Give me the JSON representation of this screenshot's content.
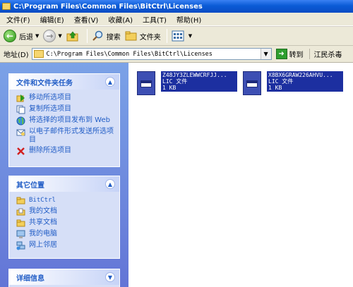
{
  "window": {
    "title": "C:\\Program Files\\Common Files\\BitCtrl\\Licenses"
  },
  "menu": [
    "文件(F)",
    "编辑(E)",
    "查看(V)",
    "收藏(A)",
    "工具(T)",
    "帮助(H)"
  ],
  "toolbar": {
    "back_label": "后退",
    "search_label": "搜索",
    "folders_label": "文件夹"
  },
  "address": {
    "label": "地址(D)",
    "value": "C:\\Program Files\\Common Files\\BitCtrl\\Licenses",
    "go_label": "转到",
    "extra_label": "江民杀毒"
  },
  "tasks_panel": {
    "title": "文件和文件夹任务",
    "items": [
      "移动所选项目",
      "复制所选项目",
      "将选择的项目发布到 Web",
      "以电子邮件形式发送所选项目",
      "删除所选项目"
    ]
  },
  "places_panel": {
    "title": "其它位置",
    "items": [
      "BitCtrl",
      "我的文档",
      "共享文档",
      "我的电脑",
      "网上邻居"
    ]
  },
  "details_panel": {
    "title": "详细信息"
  },
  "files": [
    {
      "name": "Z48JY3ZLEWWCRFJJ...",
      "type": "LIC 文件",
      "size": "1 KB"
    },
    {
      "name": "X8BX6GRAW226AHVU...",
      "type": "LIC 文件",
      "size": "1 KB"
    }
  ]
}
